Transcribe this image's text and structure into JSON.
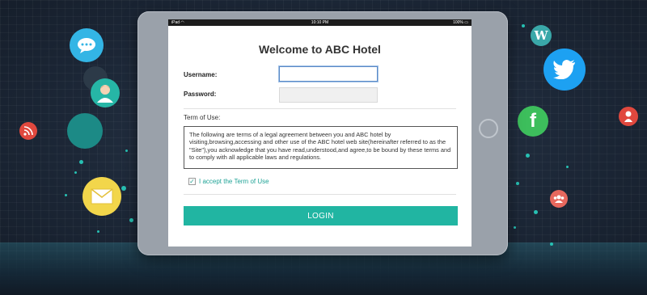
{
  "status_bar": {
    "device": "iPad",
    "wifi_icon": "wifi-icon",
    "time": "10:10 PM",
    "battery": "100%"
  },
  "login": {
    "title": "Welcome to ABC Hotel",
    "username_label": "Username:",
    "username_value": "",
    "password_label": "Password:",
    "password_value": "",
    "terms_label": "Term of Use:",
    "terms_text": "The following are terms of a legal agreement between you and ABC hotel by visiting,browsing,accessing and other use of the ABC hotel web site(hereinafter referred to as the \"Site\"),you acknowledge that you have read,understood,and agree,to be bound by these terms and to comply with all applicable laws and regulations.",
    "accept_label": "I accept the Term of Use",
    "accept_checked": true,
    "button_label": "LOGIN"
  },
  "social_icons": [
    "chat-icon",
    "person-icon",
    "rss-icon",
    "mail-icon",
    "wordpress-icon",
    "twitter-icon",
    "facebook-icon",
    "google-plus-icon",
    "group-icon"
  ],
  "colors": {
    "accent": "#21b5a2",
    "twitter": "#1da1f2",
    "facebook": "#3dbe5c",
    "mail": "#f2d64b",
    "rss": "#e0483e",
    "google_plus": "#e0483e",
    "group": "#e7685e",
    "chat": "#33b5e5"
  }
}
